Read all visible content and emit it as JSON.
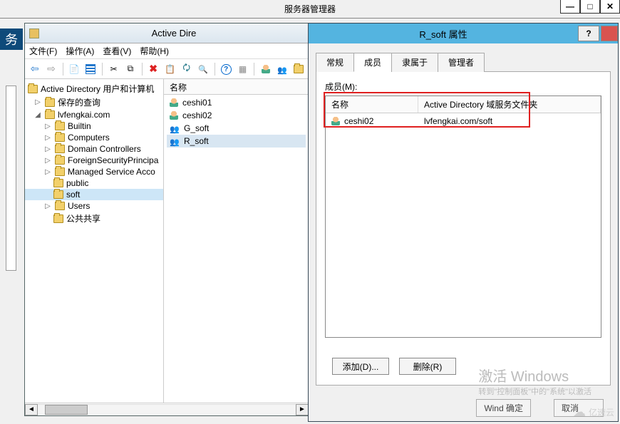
{
  "main_window": {
    "title": "服务器管理器"
  },
  "left_sliver_label": "务",
  "ad_window": {
    "title": "Active Dire",
    "menu": {
      "file": "文件(F)",
      "action": "操作(A)",
      "view": "查看(V)",
      "help": "帮助(H)"
    },
    "tree": {
      "root": "Active Directory 用户和计算机",
      "saved_queries": "保存的查询",
      "domain": "lvfengkai.com",
      "children": {
        "builtin": "Builtin",
        "computers": "Computers",
        "domain_controllers": "Domain Controllers",
        "fsp": "ForeignSecurityPrincipa",
        "msa": "Managed Service Acco",
        "public": "public",
        "soft": "soft",
        "users": "Users",
        "public_share": "公共共享"
      }
    },
    "list": {
      "header_name": "名称",
      "items": [
        {
          "name": "ceshi01",
          "type": "user"
        },
        {
          "name": "ceshi02",
          "type": "user"
        },
        {
          "name": "G_soft",
          "type": "group"
        },
        {
          "name": "R_soft",
          "type": "group"
        }
      ]
    }
  },
  "prop_dialog": {
    "title": "R_soft 属性",
    "help": "?",
    "tabs": {
      "general": "常规",
      "members": "成员",
      "memberof": "隶属于",
      "managedby": "管理者"
    },
    "members_label": "成员(M):",
    "columns": {
      "name": "名称",
      "folder": "Active Directory 域服务文件夹"
    },
    "rows": [
      {
        "name": "ceshi02",
        "folder": "lvfengkai.com/soft"
      }
    ],
    "buttons": {
      "add": "添加(D)...",
      "remove": "删除(R)",
      "ok_partial": "Wind 确定",
      "cancel": "取消"
    }
  },
  "watermark": {
    "line1": "激活 Windows",
    "line2": "转到\"控制面板\"中的\"系统\"以激活",
    "logo": "亿速云"
  }
}
